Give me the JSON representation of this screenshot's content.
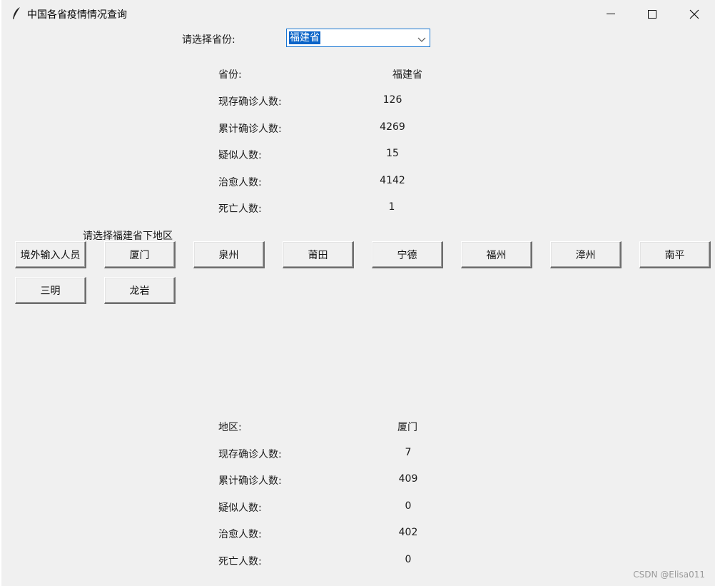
{
  "window": {
    "title": "中国各省疫情情况查询"
  },
  "province_select": {
    "label": "请选择省份:",
    "selected": "福建省"
  },
  "province_stats": {
    "province_label": "省份:",
    "province_value": "福建省",
    "current_confirmed_label": "现存确诊人数:",
    "current_confirmed_value": "126",
    "total_confirmed_label": "累计确诊人数:",
    "total_confirmed_value": "4269",
    "suspected_label": "疑似人数:",
    "suspected_value": "15",
    "cured_label": "治愈人数:",
    "cured_value": "4142",
    "dead_label": "死亡人数:",
    "dead_value": "1"
  },
  "region_prompt": "请选择福建省下地区",
  "regions": [
    "境外输入人员",
    "厦门",
    "泉州",
    "莆田",
    "宁德",
    "福州",
    "漳州",
    "南平",
    "三明",
    "龙岩"
  ],
  "region_stats": {
    "region_label": "地区:",
    "region_value": "厦门",
    "current_confirmed_label": "现存确诊人数:",
    "current_confirmed_value": "7",
    "total_confirmed_label": "累计确诊人数:",
    "total_confirmed_value": "409",
    "suspected_label": "疑似人数:",
    "suspected_value": "0",
    "cured_label": "治愈人数:",
    "cured_value": "402",
    "dead_label": "死亡人数:",
    "dead_value": "0"
  },
  "watermark": "CSDN @Elisa011"
}
